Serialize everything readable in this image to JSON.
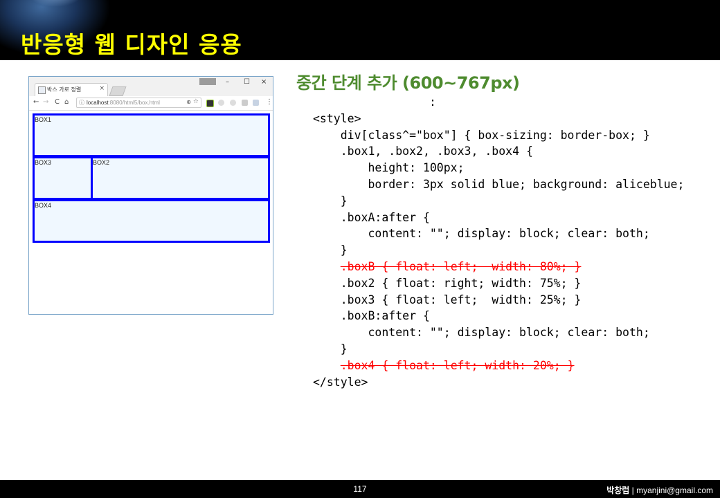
{
  "header": {
    "title": "반응형 웹 디자인 응용"
  },
  "browser": {
    "tab_title": "박스 가로 정렬",
    "tab_close": "×",
    "window_controls": {
      "minimize": "–",
      "maximize": "☐",
      "close": "×"
    },
    "nav": {
      "back": "←",
      "forward": "→",
      "reload": "C",
      "home": "⌂"
    },
    "url_host": "localhost",
    "url_path": ":8080/html5/box.html",
    "url_info_icon": "ⓘ",
    "zoom_icon": "⊕",
    "star_icon": "☆",
    "menu_icon": "⋮",
    "boxes": {
      "box1": "BOX1",
      "box3": "BOX3",
      "box2": "BOX2",
      "box4": "BOX4"
    }
  },
  "section_title": "중간 단계 추가 (600~767px)",
  "code": {
    "dots": ":",
    "lines": [
      "<style>",
      "    div[class^=\"box\"] { box-sizing: border-box; }",
      "    .box1, .box2, .box3, .box4 {",
      "        height: 100px;",
      "        border: 3px solid blue; background: aliceblue;",
      "    }",
      "    .boxA:after {",
      "        content: \"\"; display: block; clear: both;",
      "    }",
      "    ",
      "    .box2 { float: right; width: 75%; }",
      "    .box3 { float: left;  width: 25%; }",
      "    .boxB:after {",
      "        content: \"\"; display: block; clear: both;",
      "    }",
      "    ",
      "</style>"
    ],
    "struck_1": ".boxB { float: left;  width: 80%; }",
    "struck_2": ".box4 { float: left; width: 20%; }"
  },
  "footer": {
    "page": "117",
    "author_name": "박창럼",
    "author_sep": " | ",
    "author_email": "myanjini@gmail.com"
  }
}
